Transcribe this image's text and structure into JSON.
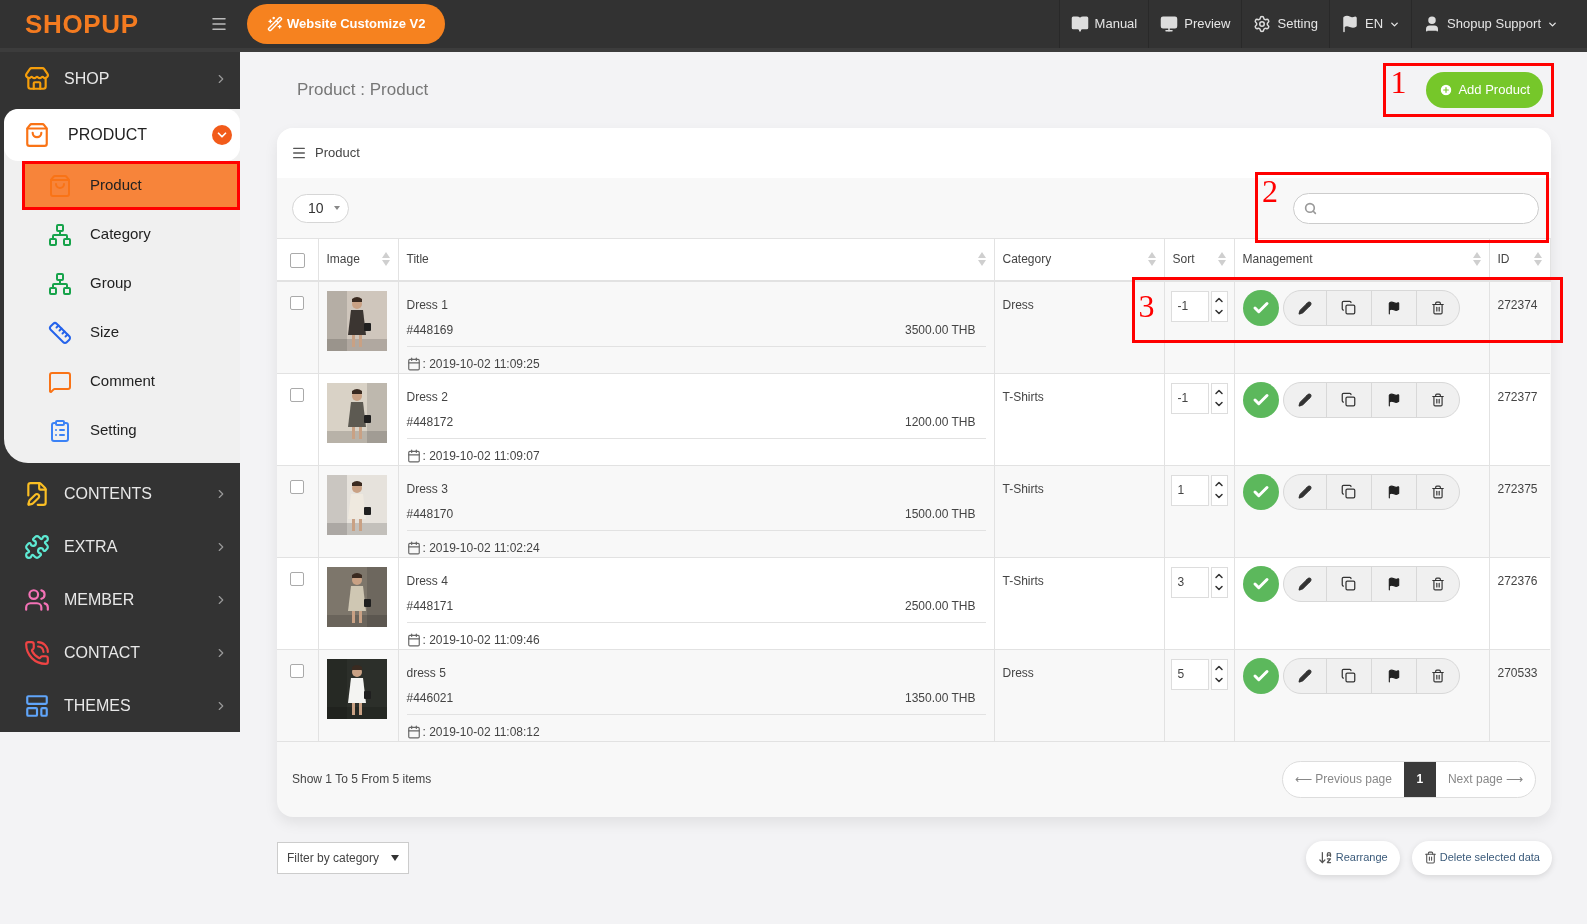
{
  "topbar": {
    "logo": "SHOPUP",
    "customize_button": "Website Customize V2",
    "links": [
      {
        "kind": "book",
        "label": "Manual",
        "dropdown": false
      },
      {
        "kind": "monitor",
        "label": "Preview",
        "dropdown": false
      },
      {
        "kind": "gear",
        "label": "Setting",
        "dropdown": false
      },
      {
        "kind": "flag",
        "label": "EN",
        "dropdown": true
      },
      {
        "kind": "person",
        "label": "Shopup Support",
        "dropdown": true
      }
    ]
  },
  "sidebar": {
    "items": [
      {
        "kind": "shop",
        "label": "SHOP",
        "expanded": false
      },
      {
        "kind": "product",
        "label": "PRODUCT",
        "expanded": true,
        "children": [
          {
            "kind": "product",
            "label": "Product",
            "selected": true,
            "annotated": true
          },
          {
            "kind": "tree",
            "label": "Category",
            "selected": false,
            "annotated": false
          },
          {
            "kind": "tree",
            "label": "Group",
            "selected": false,
            "annotated": false
          },
          {
            "kind": "ruler",
            "label": "Size",
            "selected": false,
            "annotated": false
          },
          {
            "kind": "comment",
            "label": "Comment",
            "selected": false,
            "annotated": false
          },
          {
            "kind": "clipboard",
            "label": "Setting",
            "selected": false,
            "annotated": false
          }
        ]
      },
      {
        "kind": "contents",
        "label": "CONTENTS",
        "expanded": false
      },
      {
        "kind": "puzzle",
        "label": "EXTRA",
        "expanded": false
      },
      {
        "kind": "people",
        "label": "MEMBER",
        "expanded": false
      },
      {
        "kind": "phone",
        "label": "CONTACT",
        "expanded": false
      },
      {
        "kind": "themes",
        "label": "THEMES",
        "expanded": false
      }
    ]
  },
  "breadcrumb": "Product : Product",
  "add_button": {
    "label": "Add Product",
    "annotation": "1"
  },
  "panel": {
    "title": "Product",
    "page_size": "10",
    "search": {
      "annotation": "2"
    },
    "select_all_checked": false,
    "columns": [
      {
        "label": "Image"
      },
      {
        "label": "Title"
      },
      {
        "label": "Category"
      },
      {
        "label": "Sort"
      },
      {
        "label": "Management"
      },
      {
        "label": "ID"
      }
    ],
    "rows": [
      {
        "checked": false,
        "title": "Dress 1",
        "code": "#448169",
        "price": "3500.00 THB",
        "date": ": 2019-10-02 11:09:25",
        "category": "Dress",
        "sort": "-1",
        "active": true,
        "id": "272374",
        "annotation": "3"
      },
      {
        "checked": false,
        "title": "Dress 2",
        "code": "#448172",
        "price": "1200.00 THB",
        "date": ": 2019-10-02 11:09:07",
        "category": "T-Shirts",
        "sort": "-1",
        "active": true,
        "id": "272377"
      },
      {
        "checked": false,
        "title": "Dress 3",
        "code": "#448170",
        "price": "1500.00 THB",
        "date": ": 2019-10-02 11:02:24",
        "category": "T-Shirts",
        "sort": "1",
        "active": true,
        "id": "272375"
      },
      {
        "checked": false,
        "title": "Dress 4",
        "code": "#448171",
        "price": "2500.00 THB",
        "date": ": 2019-10-02 11:09:46",
        "category": "T-Shirts",
        "sort": "3",
        "active": true,
        "id": "272376"
      },
      {
        "checked": false,
        "title": "dress 5",
        "code": "#446021",
        "price": "1350.00 THB",
        "date": ": 2019-10-02 11:08:12",
        "category": "Dress",
        "sort": "5",
        "active": true,
        "id": "270533"
      }
    ],
    "summary": "Show 1 To 5 From 5 items",
    "pagination": {
      "previous": "⟵ Previous page",
      "pages": [
        {
          "label": "1",
          "selected": true
        }
      ],
      "next": "Next page ⟶"
    }
  },
  "filter": "Filter by category",
  "bottom_buttons": [
    {
      "kind": "sort",
      "label": "Rearrange"
    },
    {
      "kind": "trash",
      "label": "Delete selected data"
    }
  ]
}
